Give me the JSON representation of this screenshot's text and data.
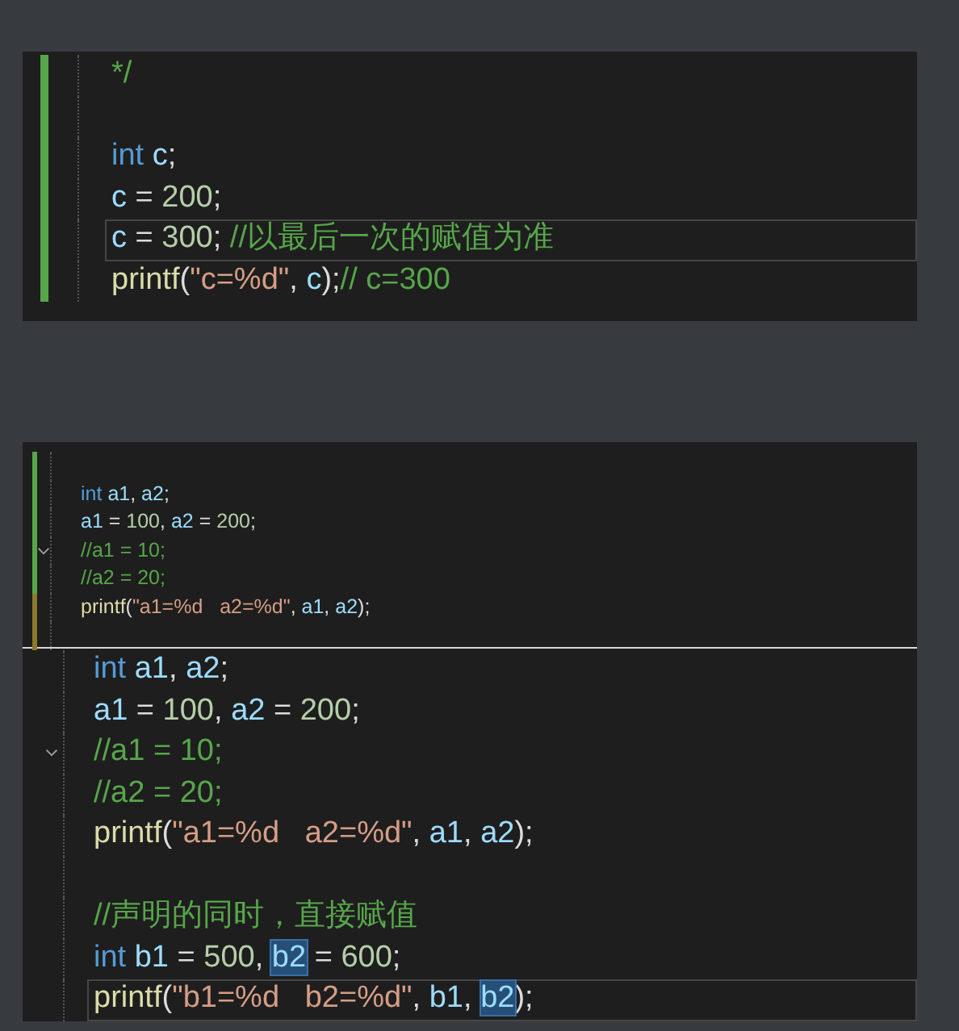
{
  "panels": [
    {
      "kind": "large",
      "lines": [
        {
          "kind": "code",
          "color": "#57a64a",
          "current": false,
          "fold": false,
          "tokens": [
            {
              "kind": "comment",
              "text": "*/"
            }
          ]
        },
        {
          "kind": "blank",
          "color": "#57a64a",
          "current": false,
          "fold": false
        },
        {
          "kind": "code",
          "color": "#57a64a",
          "current": false,
          "fold": false,
          "tokens": [
            {
              "kind": "kw",
              "text": "int "
            },
            {
              "kind": "var",
              "text": "c"
            },
            {
              "kind": "plain",
              "text": ";"
            }
          ]
        },
        {
          "kind": "code",
          "color": "#57a64a",
          "current": false,
          "fold": false,
          "tokens": [
            {
              "kind": "var",
              "text": "c"
            },
            {
              "kind": "plain",
              "text": " = "
            },
            {
              "kind": "num",
              "text": "200"
            },
            {
              "kind": "plain",
              "text": ";"
            }
          ]
        },
        {
          "kind": "code",
          "color": "#57a64a",
          "current": true,
          "fold": false,
          "tokens": [
            {
              "kind": "var",
              "text": "c"
            },
            {
              "kind": "plain",
              "text": " = "
            },
            {
              "kind": "num",
              "text": "300"
            },
            {
              "kind": "plain",
              "text": "; "
            },
            {
              "kind": "comment",
              "text": "//以最后一次的赋值为准"
            }
          ]
        },
        {
          "kind": "code",
          "color": "#57a64a",
          "current": false,
          "fold": false,
          "tokens": [
            {
              "kind": "fn",
              "text": "printf"
            },
            {
              "kind": "plain",
              "text": "("
            },
            {
              "kind": "str",
              "text": "\"c=%d\""
            },
            {
              "kind": "plain",
              "text": ", "
            },
            {
              "kind": "var",
              "text": "c"
            },
            {
              "kind": "plain",
              "text": ");"
            },
            {
              "kind": "comment",
              "text": "// c=300"
            }
          ]
        }
      ]
    },
    {
      "kind": "small",
      "lines": [
        {
          "kind": "blank",
          "color": "#57a64a",
          "current": false,
          "fold": false
        },
        {
          "kind": "code",
          "color": "#57a64a",
          "current": false,
          "fold": false,
          "tokens": [
            {
              "kind": "kw",
              "text": "int "
            },
            {
              "kind": "var",
              "text": "a1"
            },
            {
              "kind": "plain",
              "text": ", "
            },
            {
              "kind": "var",
              "text": "a2"
            },
            {
              "kind": "plain",
              "text": ";"
            }
          ]
        },
        {
          "kind": "code",
          "color": "#57a64a",
          "current": false,
          "fold": false,
          "tokens": [
            {
              "kind": "var",
              "text": "a1"
            },
            {
              "kind": "plain",
              "text": " = "
            },
            {
              "kind": "num",
              "text": "100"
            },
            {
              "kind": "plain",
              "text": ", "
            },
            {
              "kind": "var",
              "text": "a2"
            },
            {
              "kind": "plain",
              "text": " = "
            },
            {
              "kind": "num",
              "text": "200"
            },
            {
              "kind": "plain",
              "text": ";"
            }
          ]
        },
        {
          "kind": "code",
          "color": "#57a64a",
          "current": false,
          "fold": true,
          "tokens": [
            {
              "kind": "comment",
              "text": "//a1 = 10;"
            }
          ]
        },
        {
          "kind": "code",
          "color": "#57a64a",
          "current": false,
          "fold": false,
          "tokens": [
            {
              "kind": "comment",
              "text": "//a2 = 20;"
            }
          ]
        },
        {
          "kind": "code",
          "color": "#8a7a2a",
          "current": false,
          "fold": false,
          "tokens": [
            {
              "kind": "fn",
              "text": "printf"
            },
            {
              "kind": "plain",
              "text": "("
            },
            {
              "kind": "str",
              "text": "\"a1=%d   a2=%d\""
            },
            {
              "kind": "plain",
              "text": ", "
            },
            {
              "kind": "var",
              "text": "a1"
            },
            {
              "kind": "plain",
              "text": ", "
            },
            {
              "kind": "var",
              "text": "a2"
            },
            {
              "kind": "plain",
              "text": ");"
            }
          ]
        },
        {
          "kind": "blank",
          "color": "#8a7a2a",
          "current": false,
          "fold": false
        }
      ]
    },
    {
      "kind": "large",
      "lines": [
        {
          "kind": "code",
          "current": false,
          "fold": false,
          "tokens": [
            {
              "kind": "kw",
              "text": "int "
            },
            {
              "kind": "var",
              "text": "a1"
            },
            {
              "kind": "plain",
              "text": ", "
            },
            {
              "kind": "var",
              "text": "a2"
            },
            {
              "kind": "plain",
              "text": ";"
            }
          ]
        },
        {
          "kind": "code",
          "current": false,
          "fold": false,
          "tokens": [
            {
              "kind": "var",
              "text": "a1"
            },
            {
              "kind": "plain",
              "text": " = "
            },
            {
              "kind": "num",
              "text": "100"
            },
            {
              "kind": "plain",
              "text": ", "
            },
            {
              "kind": "var",
              "text": "a2"
            },
            {
              "kind": "plain",
              "text": " = "
            },
            {
              "kind": "num",
              "text": "200"
            },
            {
              "kind": "plain",
              "text": ";"
            }
          ]
        },
        {
          "kind": "code",
          "current": false,
          "fold": true,
          "tokens": [
            {
              "kind": "comment",
              "text": "//a1 = 10;"
            }
          ]
        },
        {
          "kind": "code",
          "current": false,
          "fold": false,
          "tokens": [
            {
              "kind": "comment",
              "text": "//a2 = 20;"
            }
          ]
        },
        {
          "kind": "code",
          "current": false,
          "fold": false,
          "tokens": [
            {
              "kind": "fn",
              "text": "printf"
            },
            {
              "kind": "plain",
              "text": "("
            },
            {
              "kind": "str",
              "text": "\"a1=%d   a2=%d\""
            },
            {
              "kind": "plain",
              "text": ", "
            },
            {
              "kind": "var",
              "text": "a1"
            },
            {
              "kind": "plain",
              "text": ", "
            },
            {
              "kind": "var",
              "text": "a2"
            },
            {
              "kind": "plain",
              "text": ");"
            }
          ]
        },
        {
          "kind": "blank",
          "current": false,
          "fold": false
        },
        {
          "kind": "code",
          "current": false,
          "fold": false,
          "tokens": [
            {
              "kind": "comment",
              "text": "//声明的同时，直接赋值"
            }
          ]
        },
        {
          "kind": "code",
          "current": false,
          "fold": false,
          "tokens": [
            {
              "kind": "kw",
              "text": "int "
            },
            {
              "kind": "var",
              "text": "b1"
            },
            {
              "kind": "plain",
              "text": " = "
            },
            {
              "kind": "num",
              "text": "500"
            },
            {
              "kind": "plain",
              "text": ", "
            },
            {
              "kind": "match",
              "text": "b2"
            },
            {
              "kind": "plain",
              "text": " = "
            },
            {
              "kind": "num",
              "text": "600"
            },
            {
              "kind": "plain",
              "text": ";"
            }
          ]
        },
        {
          "kind": "code",
          "current": true,
          "fold": false,
          "tokens": [
            {
              "kind": "fn",
              "text": "printf"
            },
            {
              "kind": "plain",
              "text": "("
            },
            {
              "kind": "str",
              "text": "\"b1=%d   b2=%d\""
            },
            {
              "kind": "plain",
              "text": ", "
            },
            {
              "kind": "var",
              "text": "b1"
            },
            {
              "kind": "plain",
              "text": ", "
            },
            {
              "kind": "match",
              "text": "b2"
            },
            {
              "kind": "plain",
              "text": ");"
            }
          ]
        }
      ]
    }
  ]
}
